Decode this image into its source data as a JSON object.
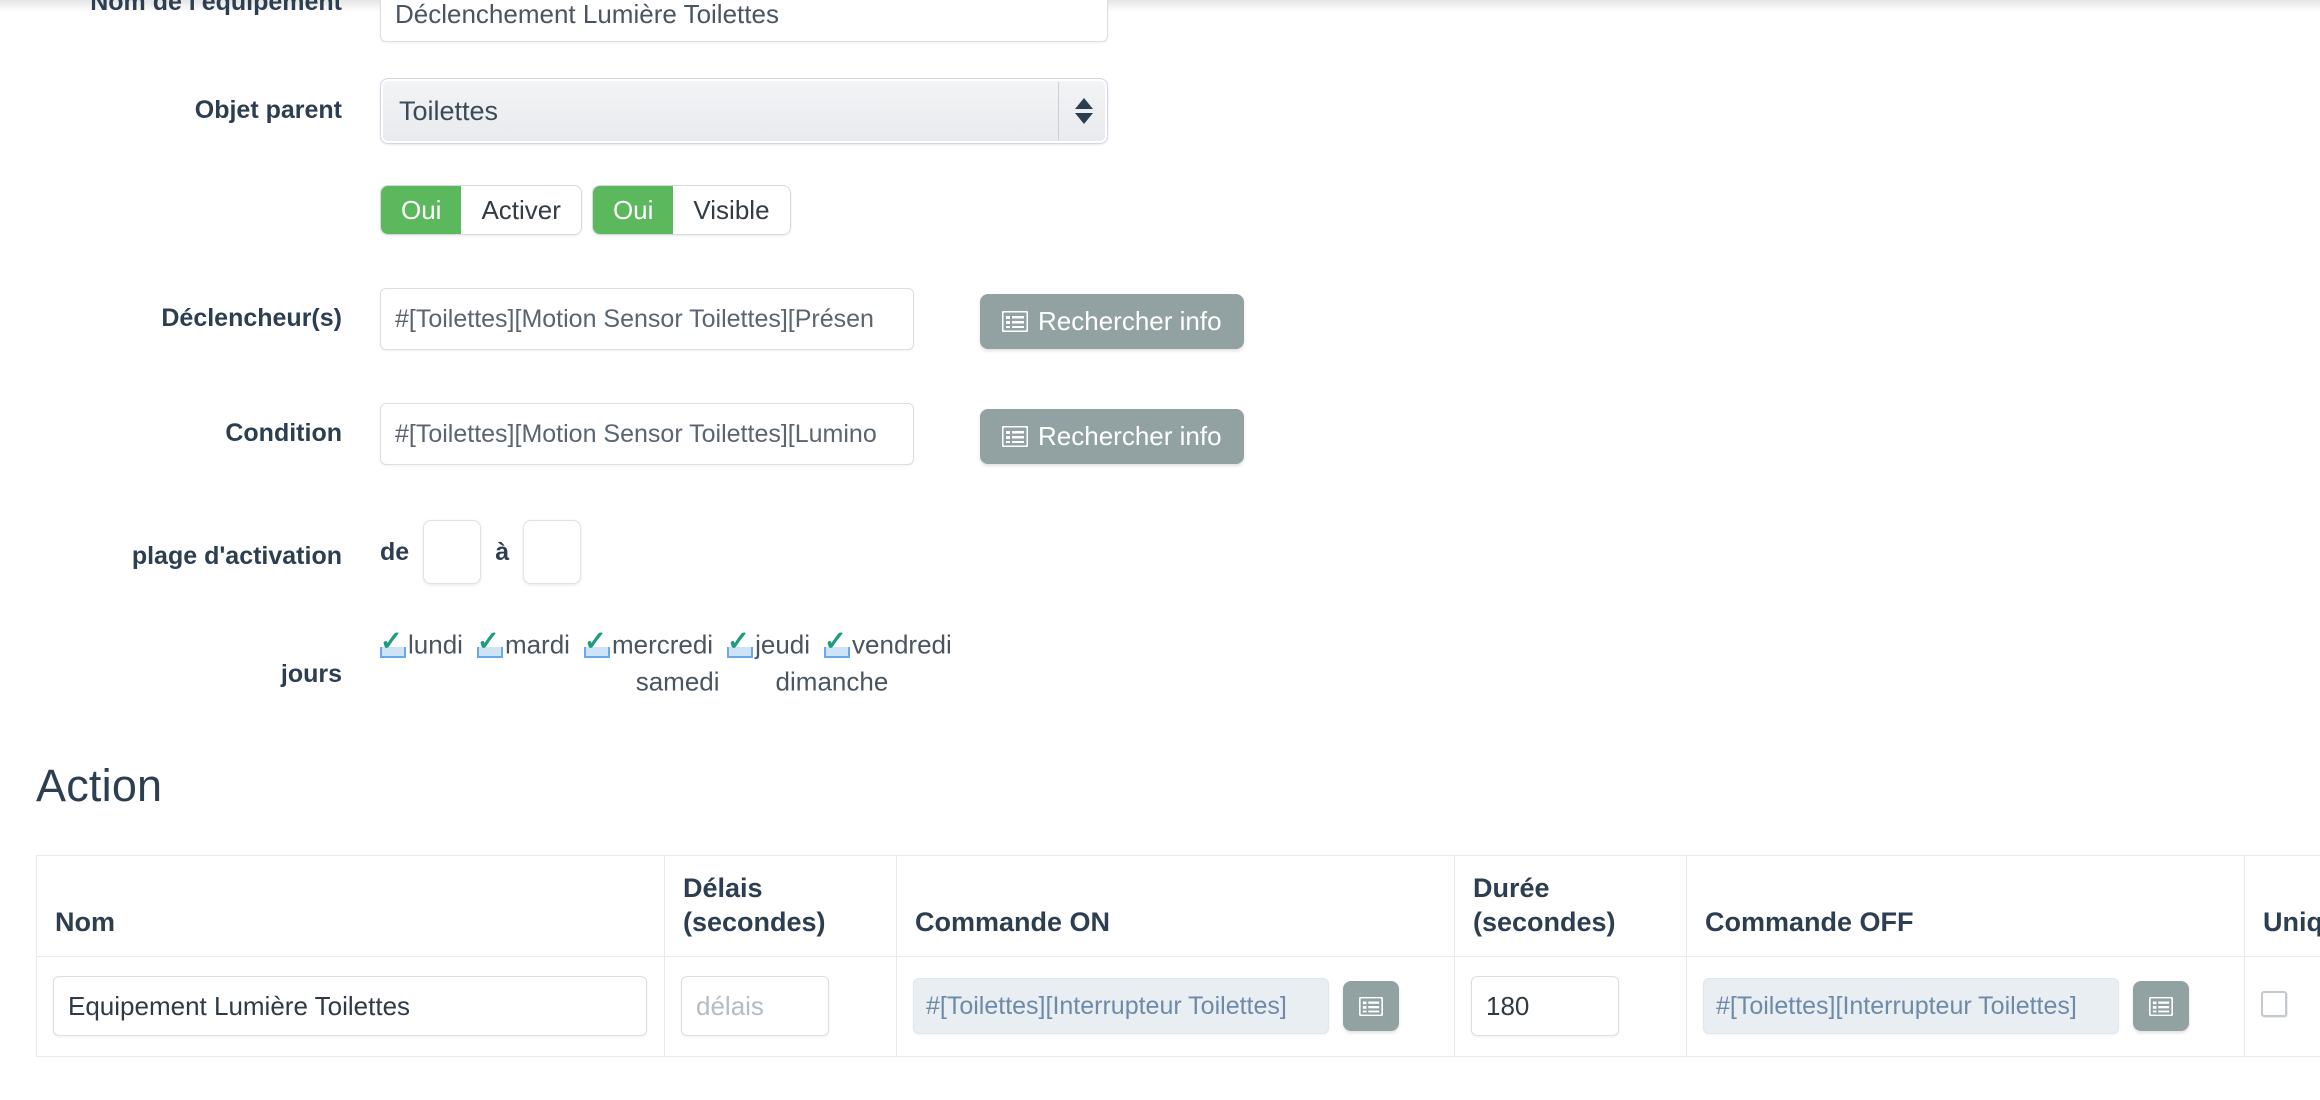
{
  "form": {
    "name_row": {
      "label": "Nom de l'équipement",
      "value": "Déclenchement Lumière Toilettes"
    },
    "parent_row": {
      "label": "Objet parent",
      "value": "Toilettes"
    },
    "toggles": [
      {
        "state_label": "Oui",
        "name_label": "Activer"
      },
      {
        "state_label": "Oui",
        "name_label": "Visible"
      }
    ],
    "trigger_row": {
      "label": "Déclencheur(s)",
      "value": "#[Toilettes][Motion Sensor Toilettes][Présen",
      "button_label": "Rechercher info",
      "button_icon": "list-icon"
    },
    "condition_row": {
      "label": "Condition",
      "value": "#[Toilettes][Motion Sensor Toilettes][Lumino",
      "button_label": "Rechercher info",
      "button_icon": "list-icon"
    },
    "plage_row": {
      "label": "plage d'activation",
      "from_word": "de",
      "from_value": "",
      "to_word": "à",
      "to_value": ""
    },
    "jours_row": {
      "label": "jours",
      "days_line1": [
        {
          "name": "lundi",
          "checked": true
        },
        {
          "name": "mardi",
          "checked": true
        },
        {
          "name": "mercredi",
          "checked": true
        },
        {
          "name": "jeudi",
          "checked": true
        },
        {
          "name": "vendredi",
          "checked": true
        }
      ],
      "days_line2": [
        {
          "name": "samedi",
          "checked": false
        },
        {
          "name": "dimanche",
          "checked": false
        }
      ]
    }
  },
  "action_section": {
    "heading": "Action",
    "columns": [
      "Nom",
      "Délais\n(secondes)",
      "Commande ON",
      "Durée\n(secondes)",
      "Commande OFF",
      "Unique"
    ],
    "col_nom": "Nom",
    "col_delais_l1": "Délais",
    "col_delais_l2": "(secondes)",
    "col_on": "Commande ON",
    "col_duree_l1": "Durée",
    "col_duree_l2": "(secondes)",
    "col_off": "Commande OFF",
    "col_unique": "Unique",
    "rows": [
      {
        "nom": "Equipement Lumière Toilettes",
        "delais": "",
        "delais_placeholder": "délais",
        "commande_on": "#[Toilettes][Interrupteur Toilettes]",
        "commande_on_button_icon": "list-icon",
        "duree": "180",
        "commande_off": "#[Toilettes][Interrupteur Toilettes]",
        "commande_off_button_icon": "list-icon",
        "unique_checked": false
      }
    ]
  },
  "colors": {
    "toggle_on": "#5cb85c",
    "button_grey": "#92a2a2",
    "label_text": "#2c3e50",
    "expression_text": "#6e8aa8",
    "check_green": "#1a9e7f",
    "check_blue": "#6aa9e9"
  }
}
